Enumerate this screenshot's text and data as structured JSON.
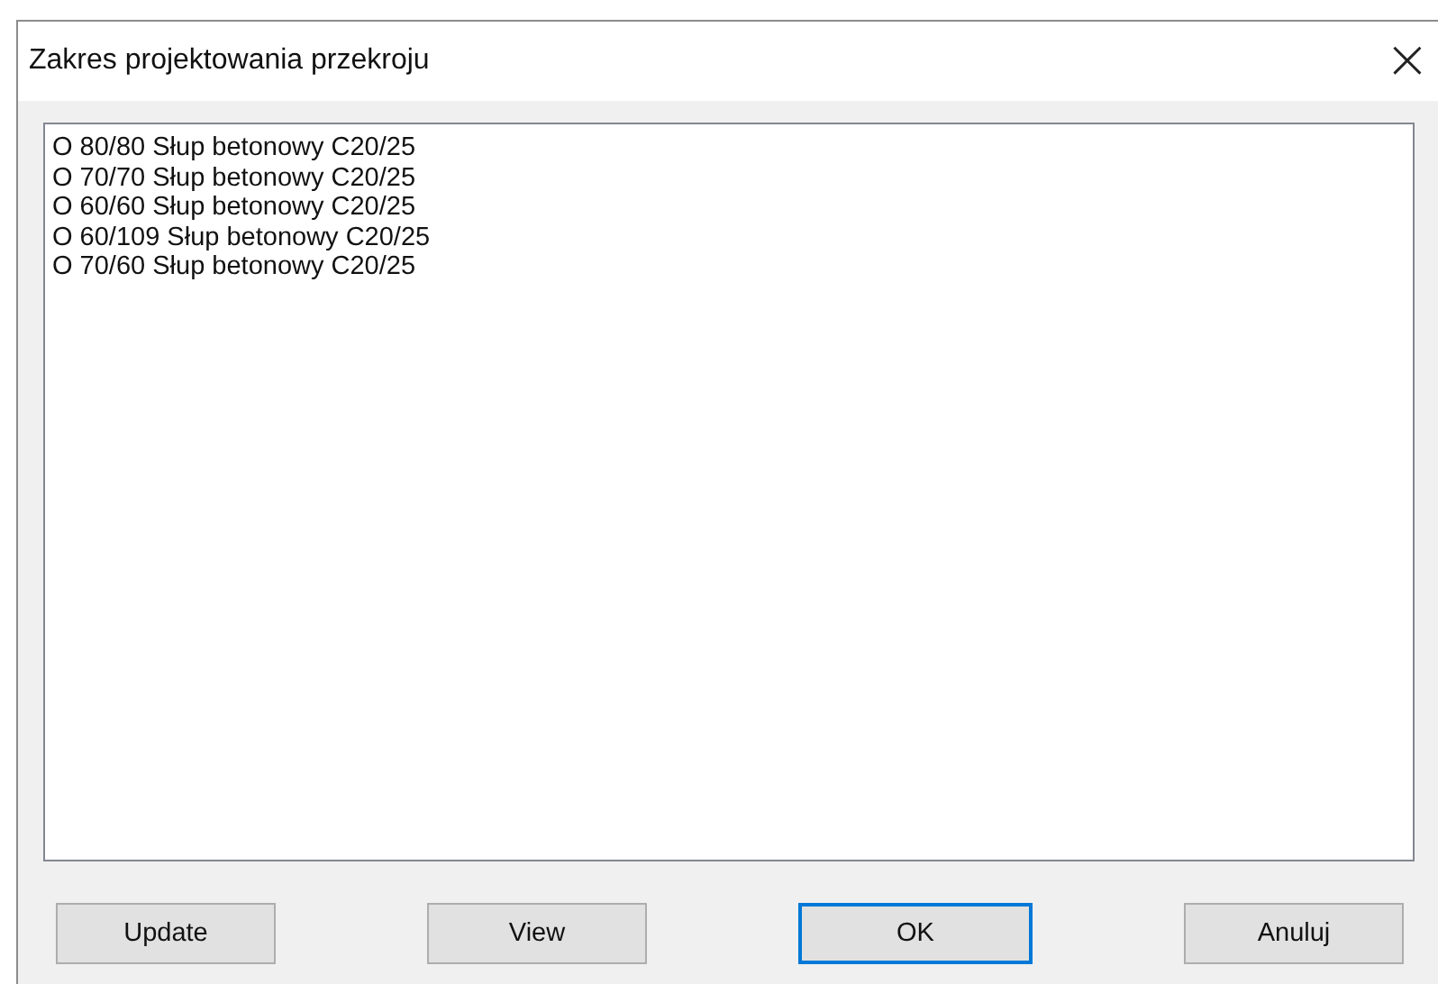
{
  "window": {
    "title": "Zakres projektowania przekroju",
    "close": "×"
  },
  "list": {
    "items": [
      {
        "text": "O 80/80 Słup betonowy C20/25"
      },
      {
        "text": "O 70/70 Słup betonowy C20/25"
      },
      {
        "text": "O 60/60 Słup betonowy C20/25"
      },
      {
        "text": "O 60/109 Słup betonowy C20/25"
      },
      {
        "text": "O 70/60 Słup betonowy C20/25"
      }
    ]
  },
  "buttons": [
    {
      "label": "Update",
      "focused": false
    },
    {
      "label": "View",
      "focused": false
    },
    {
      "label": "OK",
      "focused": true
    },
    {
      "label": "Anuluj",
      "focused": false
    }
  ]
}
